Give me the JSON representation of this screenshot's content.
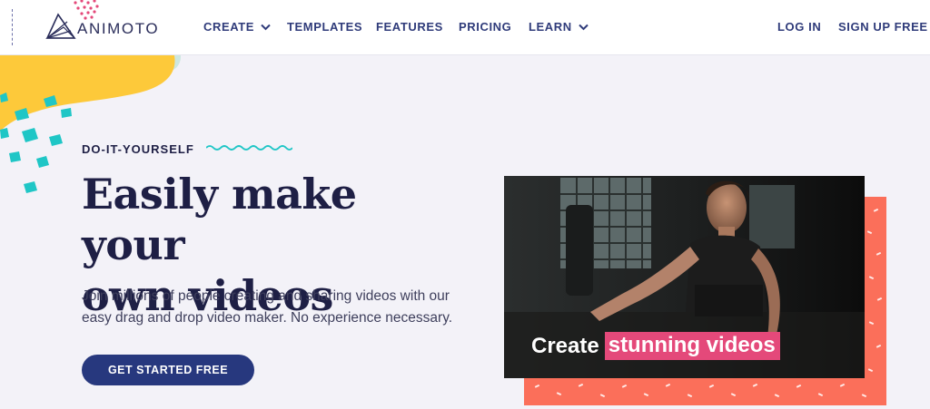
{
  "header": {
    "logo_text": "ANIMOTO",
    "nav": [
      {
        "label": "CREATE",
        "has_dropdown": true
      },
      {
        "label": "TEMPLATES",
        "has_dropdown": false
      },
      {
        "label": "FEATURES",
        "has_dropdown": false
      },
      {
        "label": "PRICING",
        "has_dropdown": false
      },
      {
        "label": "LEARN",
        "has_dropdown": true
      }
    ],
    "login_label": "LOG IN",
    "signup_label": "SIGN UP FREE"
  },
  "hero": {
    "eyebrow": "DO-IT-YOURSELF",
    "headline_line1": "Easily make your",
    "headline_line2": "own videos",
    "subtext": "Join millions of people creating and sharing videos with our easy drag and drop video maker. No experience necessary.",
    "cta_label": "GET STARTED FREE",
    "video_caption_plain": "Create",
    "video_caption_highlight": "stunning videos"
  },
  "colors": {
    "navy": "#27387e",
    "headline": "#1e1f45",
    "yellow": "#fdc93a",
    "teal": "#1fc6c6",
    "coral": "#fb6f5a",
    "pink": "#e4497a",
    "background": "#f3f2f8"
  }
}
